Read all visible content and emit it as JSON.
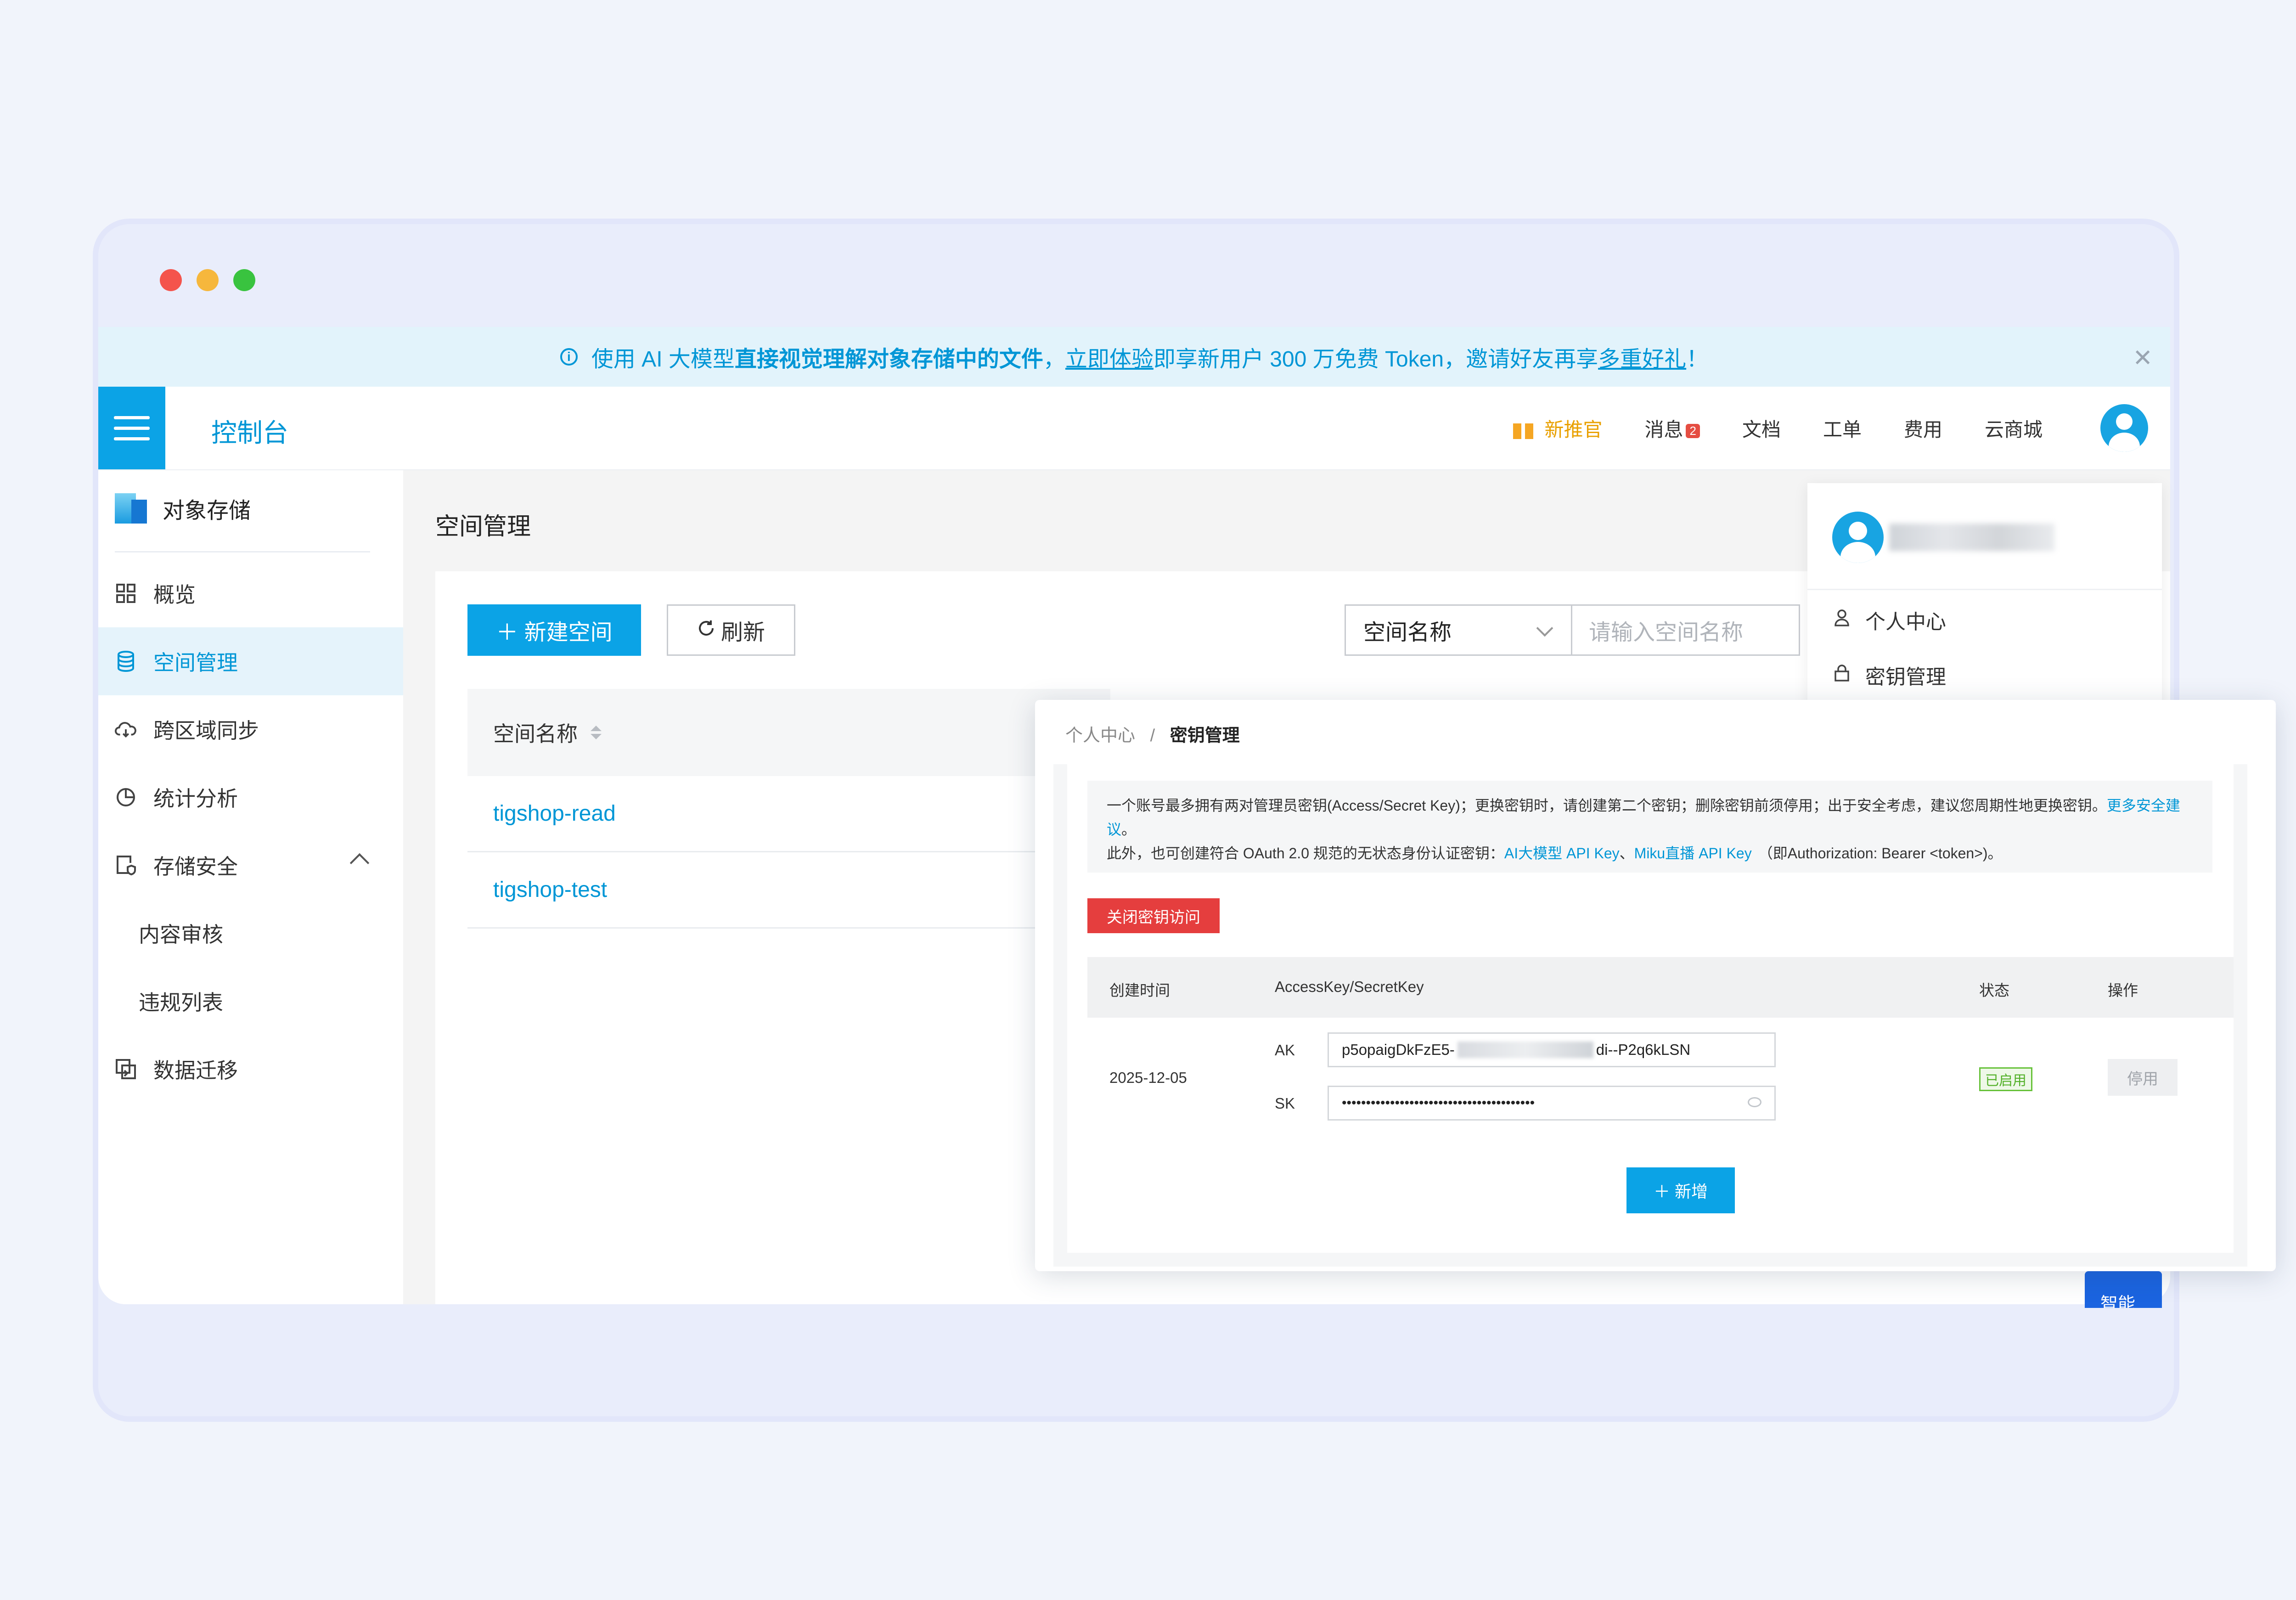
{
  "banner": {
    "prefix": "使用 AI 大模型",
    "bold1": "直接视觉理解对象存储中的文件",
    "sep": "，",
    "link": "立即体验",
    "middle": "即享新用户 300 万免费 Token，邀请好友再享",
    "link2": "多重好礼",
    "suffix": "！",
    "close": "✕"
  },
  "topbar": {
    "title": "控制台",
    "promo": "新推官",
    "messages": "消息",
    "messages_badge": "2",
    "docs": "文档",
    "tickets": "工单",
    "billing": "费用",
    "marketplace": "云商城"
  },
  "sidebar": {
    "product": "对象存储",
    "items": [
      {
        "label": "概览"
      },
      {
        "label": "空间管理"
      },
      {
        "label": "跨区域同步"
      },
      {
        "label": "统计分析"
      },
      {
        "label": "存储安全"
      },
      {
        "label": "内容审核"
      },
      {
        "label": "违规列表"
      },
      {
        "label": "数据迁移"
      }
    ]
  },
  "main": {
    "title": "空间管理",
    "new_bucket": "＋ 新建空间",
    "refresh": "刷新",
    "filter_selected": "空间名称",
    "search_placeholder": "请输入空间名称",
    "column_name": "空间名称",
    "rows": [
      "tigshop-read",
      "tigshop-test"
    ]
  },
  "dropdown": {
    "personal": "个人中心",
    "keys": "密钥管理"
  },
  "key_panel": {
    "breadcrumb_parent": "个人中心",
    "breadcrumb_sep": "/",
    "breadcrumb_current": "密钥管理",
    "note_line1": "一个账号最多拥有两对管理员密钥(Access/Secret Key)；更换密钥时，请创建第二个密钥；删除密钥前须停用；出于安全考虑，建议您周期性地更换密钥。",
    "note_link1": "更多安全建议",
    "note_line1_end": "。",
    "note_line2": "此外，也可创建符合 OAuth 2.0 规范的无状态身份认证密钥：",
    "note_link2": "AI大模型 API Key",
    "note_sep": "、",
    "note_link3": "Miku直播 API Key",
    "note_line2_end": "（即Authorization: Bearer <token>)。",
    "close_access": "关闭密钥访问",
    "col_created": "创建时间",
    "col_keys": "AccessKey/SecretKey",
    "col_status": "状态",
    "col_actions": "操作",
    "created": "2025-12-05",
    "ak_label": "AK",
    "ak_prefix": "p5opaigDkFzE5-",
    "ak_suffix": "di--P2q6kLSN",
    "sk_label": "SK",
    "sk_value": "••••••••••••••••••••••••••••••••••••••••",
    "status": "已启用",
    "disable": "停用",
    "add": "＋ 新增"
  },
  "helper": {
    "label": "智能"
  }
}
